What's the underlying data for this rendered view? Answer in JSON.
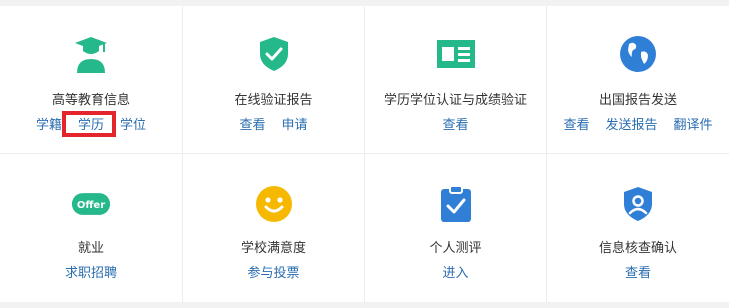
{
  "colors": {
    "green": "#25b88a",
    "blue": "#2f7fd6",
    "yellow": "#f6b800",
    "link": "#2a6db0",
    "highlight": "#e3262b"
  },
  "cards": [
    {
      "icon": "graduate-icon",
      "title": "高等教育信息",
      "links": [
        "学籍",
        "学历",
        "学位"
      ]
    },
    {
      "icon": "shield-check-icon",
      "title": "在线验证报告",
      "links": [
        "查看",
        "申请"
      ]
    },
    {
      "icon": "id-card-icon",
      "title": "学历学位认证与成绩验证",
      "links": [
        "查看"
      ]
    },
    {
      "icon": "globe-icon",
      "title": "出国报告发送",
      "links": [
        "查看",
        "发送报告",
        "翻译件"
      ]
    },
    {
      "icon": "offer-badge-icon",
      "title": "就业",
      "links": [
        "求职招聘"
      ],
      "badge_text": "Offer"
    },
    {
      "icon": "smiley-icon",
      "title": "学校满意度",
      "links": [
        "参与投票"
      ]
    },
    {
      "icon": "clipboard-check-icon",
      "title": "个人测评",
      "links": [
        "进入"
      ]
    },
    {
      "icon": "shield-user-icon",
      "title": "信息核查确认",
      "links": [
        "查看"
      ]
    }
  ]
}
